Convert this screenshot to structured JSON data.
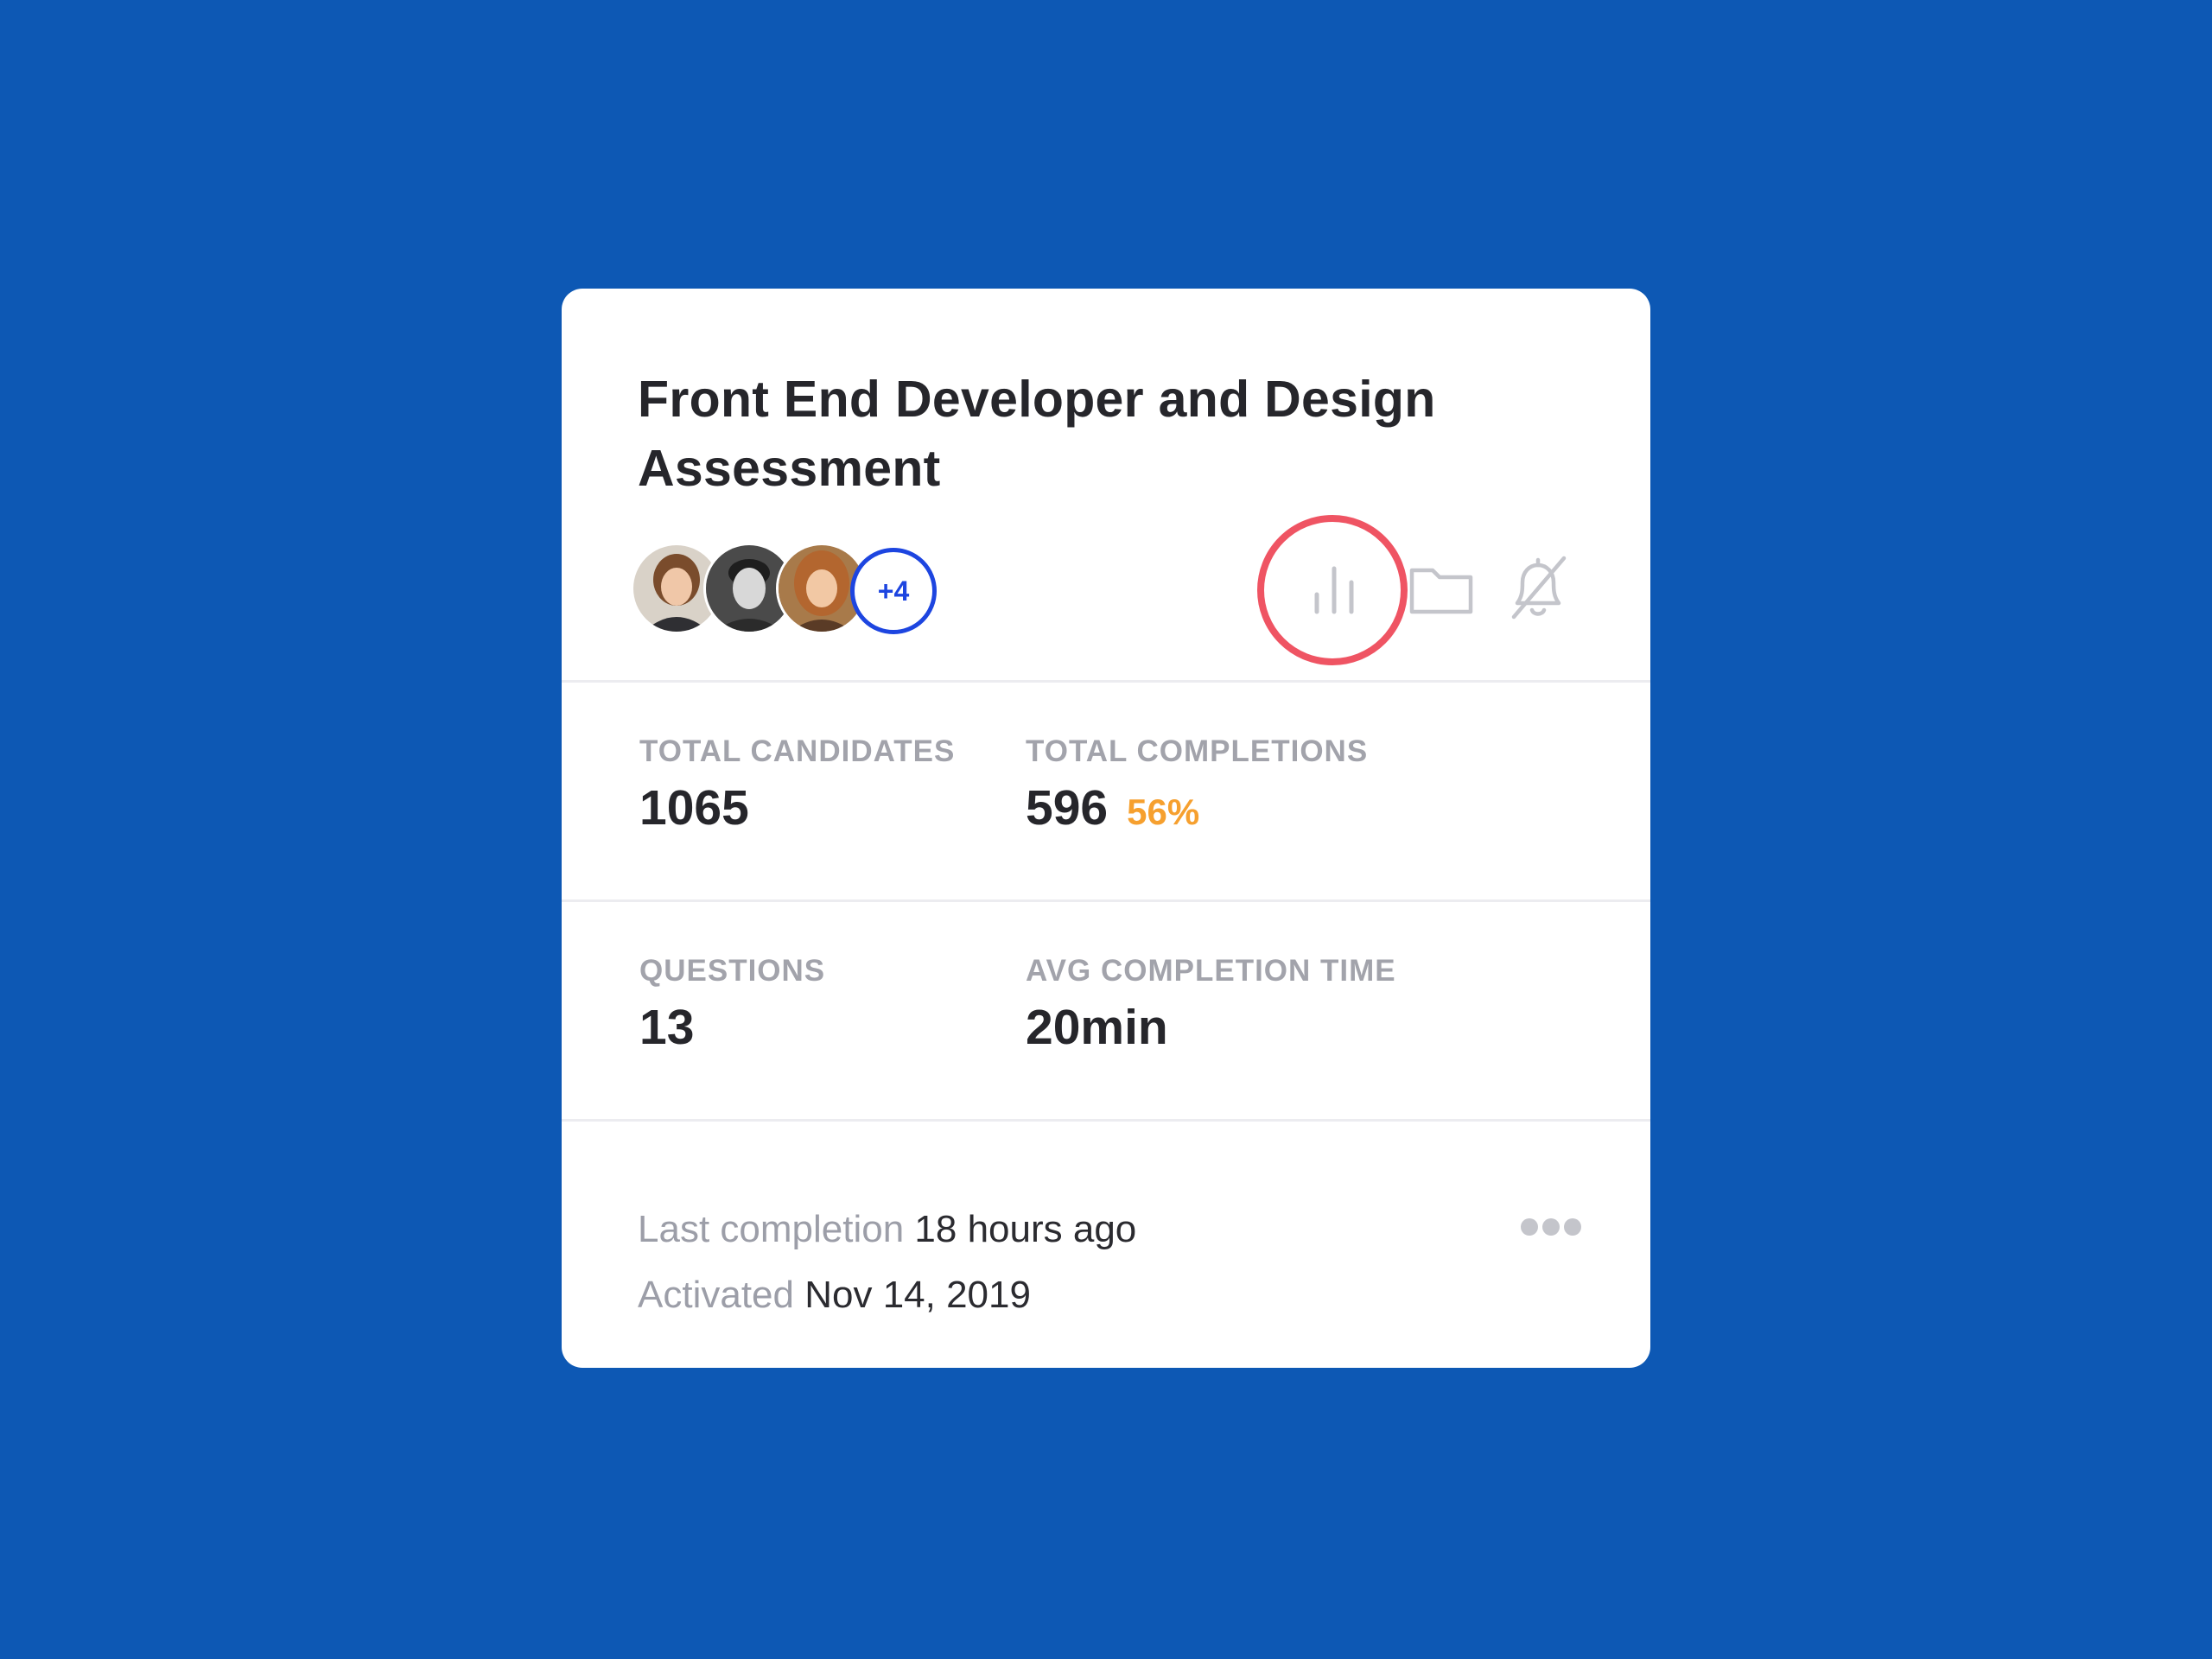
{
  "card": {
    "title": "Front End Developer and Design Assessment",
    "team": {
      "members": [
        {
          "name": "avatar-member-1"
        },
        {
          "name": "avatar-member-2"
        },
        {
          "name": "avatar-member-3"
        }
      ],
      "more_count": "+4"
    },
    "actions": [
      {
        "name": "analytics",
        "icon": "bar-chart-icon",
        "highlighted": true
      },
      {
        "name": "folder",
        "icon": "folder-icon"
      },
      {
        "name": "notifications",
        "icon": "bell-off-icon"
      }
    ],
    "stats": {
      "total_candidates": {
        "label": "TOTAL CANDIDATES",
        "value": "1065"
      },
      "total_completions": {
        "label": "TOTAL COMPLETIONS",
        "value": "596",
        "percent": "56%"
      },
      "questions": {
        "label": "QUESTIONS",
        "value": "13"
      },
      "avg_completion_time": {
        "label": "AVG COMPLETION TIME",
        "value": "20min"
      }
    },
    "footer": {
      "last_completion_label": "Last completion",
      "last_completion_value": "18 hours ago",
      "activated_label": "Activated",
      "activated_value": "Nov 14, 2019"
    }
  },
  "colors": {
    "background": "#0d58b4",
    "card": "#ffffff",
    "title": "#26262b",
    "label": "#a2a3ab",
    "accent_percent": "#f6a02f",
    "badge": "#1d45e0",
    "highlight_ring": "#ef5463",
    "icon": "#c4c5cb"
  }
}
